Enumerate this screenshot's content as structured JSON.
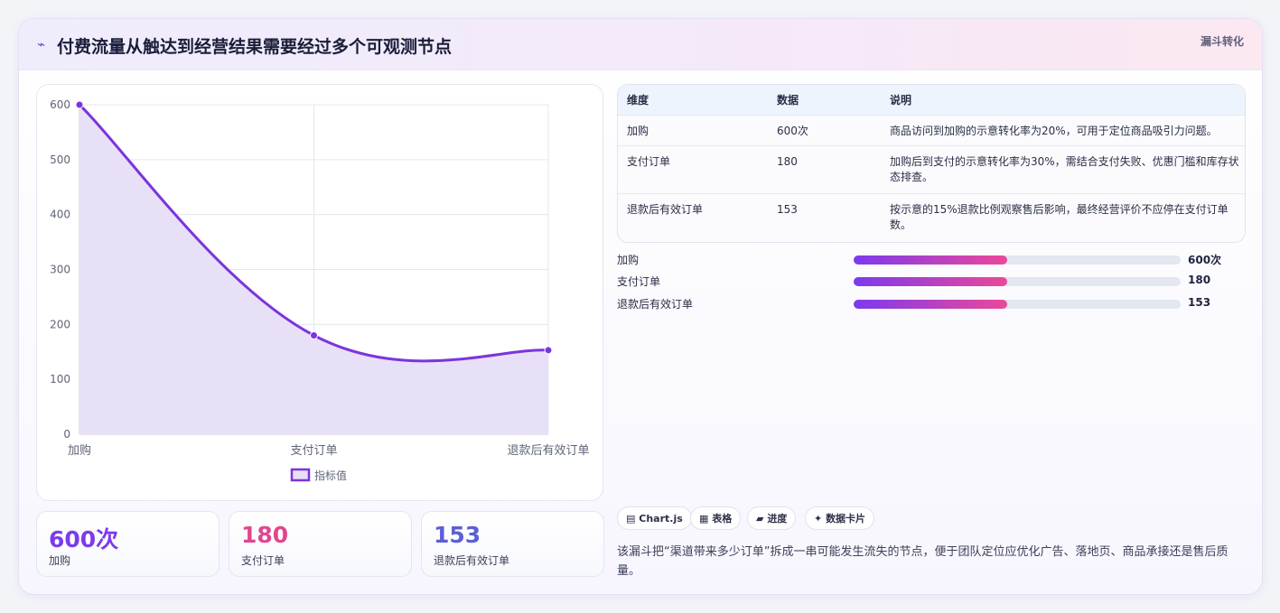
{
  "header": {
    "spark_icon": "⌁",
    "title": "付费流量从触达到经营结果需要经过多个可观测节点",
    "tag": "漏斗转化"
  },
  "chart_data": {
    "type": "area",
    "categories": [
      "加购",
      "支付订单",
      "退款后有效订单"
    ],
    "series": [
      {
        "name": "指标值",
        "values": [
          600,
          180,
          153
        ]
      }
    ],
    "ylim": [
      0,
      600
    ],
    "yticks": [
      0,
      100,
      200,
      300,
      400,
      500,
      600
    ],
    "grid": true,
    "legend": "bottom",
    "line_color": "#7b35dc",
    "fill_color": "#e8e0f7"
  },
  "stats": [
    {
      "value": "600次",
      "label": "加购",
      "color": "#7c3aed"
    },
    {
      "value": "180",
      "label": "支付订单",
      "color": "#e0468f"
    },
    {
      "value": "153",
      "label": "退款后有效订单",
      "color": "#5b5fd6"
    }
  ],
  "table": {
    "headers": [
      "维度",
      "数据",
      "说明"
    ],
    "rows": [
      [
        "加购",
        "600次",
        "商品访问到加购的示意转化率为20%，可用于定位商品吸引力问题。"
      ],
      [
        "支付订单",
        "180",
        "加购后到支付的示意转化率为30%，需结合支付失败、优惠门槛和库存状态排查。"
      ],
      [
        "退款后有效订单",
        "153",
        "按示意的15%退款比例观察售后影响，最终经营评价不应停在支付订单数。"
      ]
    ]
  },
  "progress": [
    {
      "label": "加购",
      "value": "600次",
      "fill": 0.47
    },
    {
      "label": "支付订单",
      "value": "180",
      "fill": 0.47
    },
    {
      "label": "退款后有效订单",
      "value": "153",
      "fill": 0.47
    }
  ],
  "chips": [
    {
      "icon": "▤",
      "label": "Chart.js"
    },
    {
      "icon": "▦",
      "label": "表格"
    },
    {
      "icon": "▰",
      "label": "进度"
    },
    {
      "icon": "✦",
      "label": "数据卡片"
    }
  ],
  "note": "该漏斗把“渠道带来多少订单”拆成一串可能发生流失的节点，便于团队定位应优化广告、落地页、商品承接还是售后质量。"
}
